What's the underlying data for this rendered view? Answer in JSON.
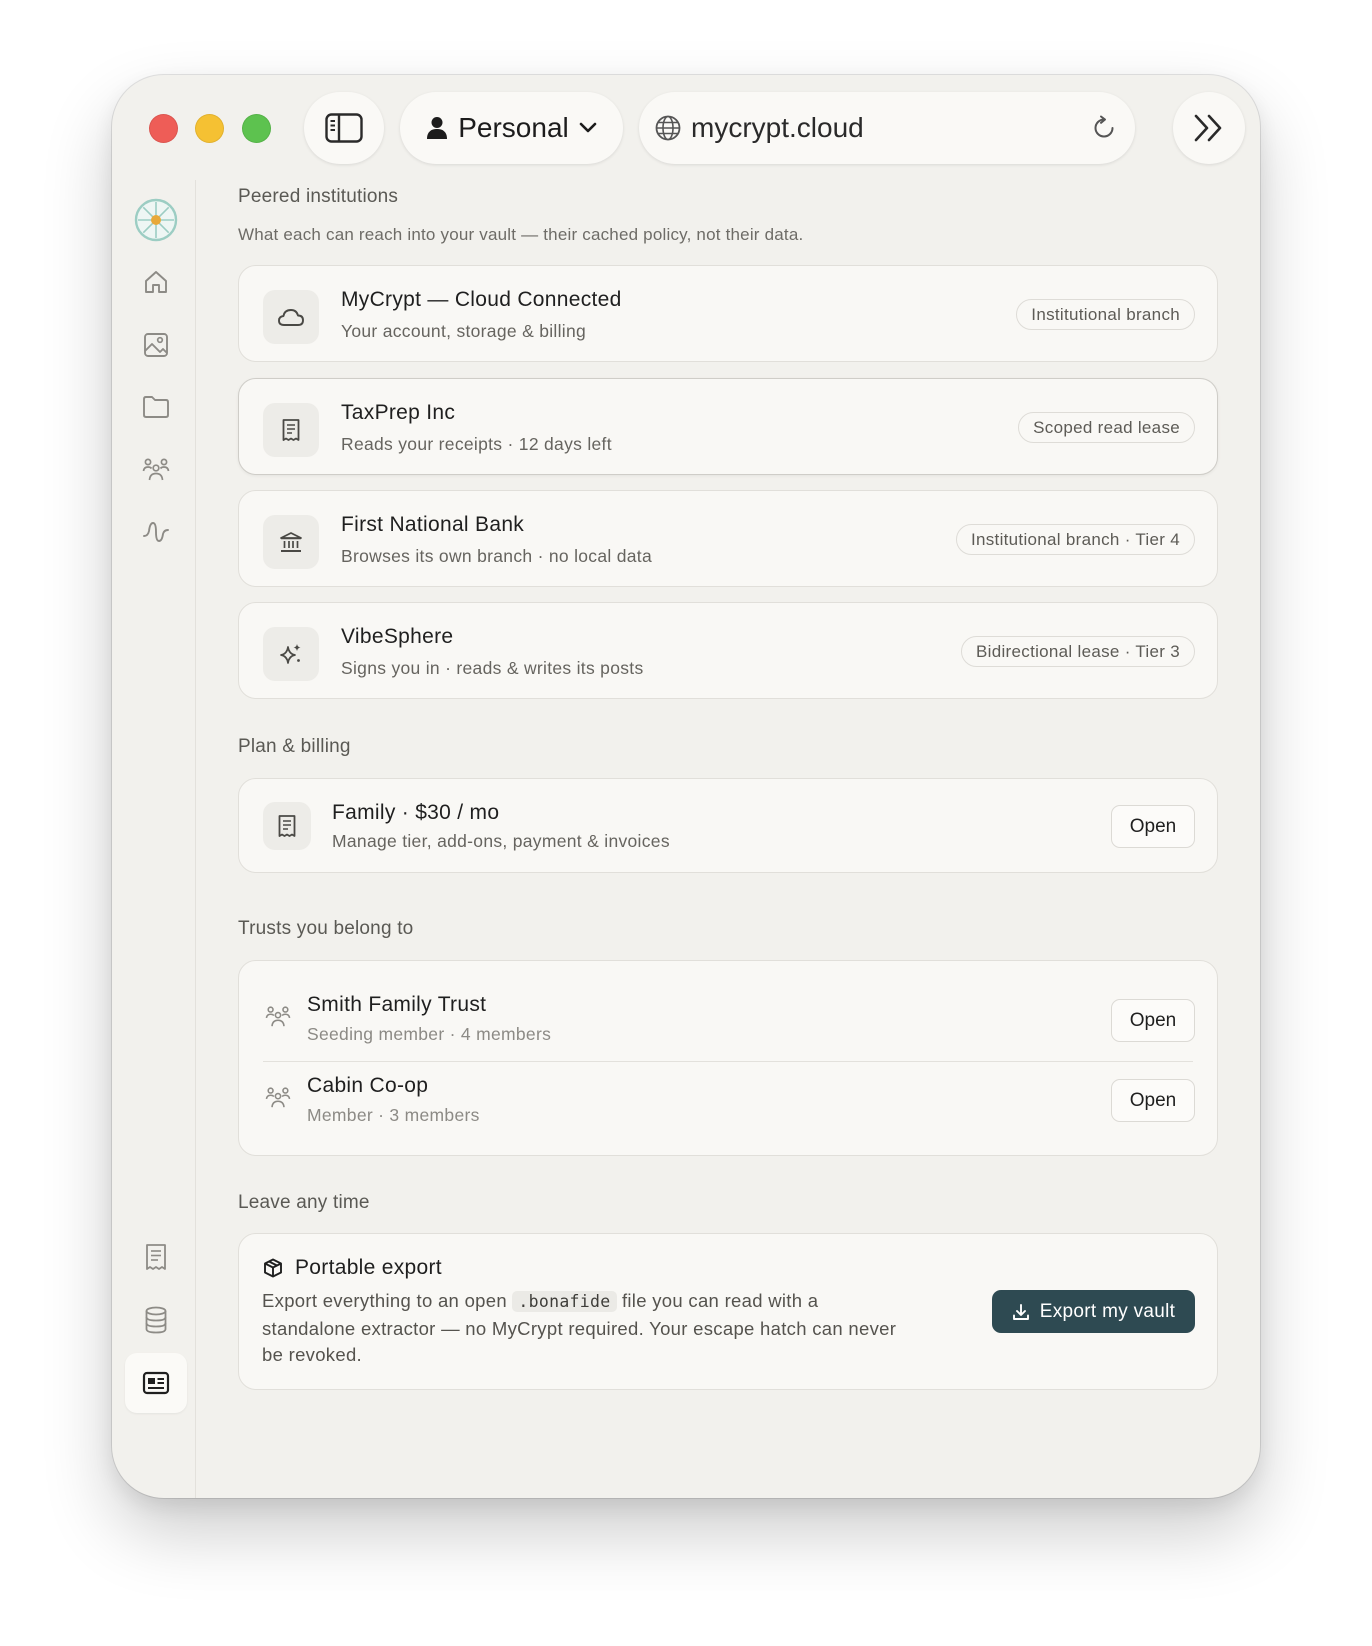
{
  "titlebar": {
    "profile_label": "Personal",
    "url": "mycrypt.cloud"
  },
  "sections": {
    "peered_title": "Peered institutions",
    "peered_subtitle": "What each can reach into your vault — their cached policy, not their data.",
    "plan_title": "Plan & billing",
    "trusts_title": "Trusts you belong to",
    "leave_title": "Leave any time"
  },
  "institutions": [
    {
      "name": "MyCrypt — Cloud Connected",
      "detail": "Your account, storage & billing",
      "tag": "Institutional branch",
      "icon": "cloud-icon"
    },
    {
      "name": "TaxPrep Inc",
      "detail": "Reads your receipts · 12 days left",
      "tag": "Scoped read lease",
      "icon": "receipt-icon"
    },
    {
      "name": "First National Bank",
      "detail": "Browses its own branch · no local data",
      "tag": "Institutional branch · Tier 4",
      "icon": "bank-icon"
    },
    {
      "name": "VibeSphere",
      "detail": "Signs you in · reads & writes its posts",
      "tag": "Bidirectional lease · Tier 3",
      "icon": "sparkles-icon"
    }
  ],
  "plan": {
    "name": "Family · $30 / mo",
    "detail": "Manage tier, add-ons, payment & invoices",
    "button": "Open"
  },
  "trusts": [
    {
      "name": "Smith Family Trust",
      "meta": "Seeding member · 4 members",
      "button": "Open"
    },
    {
      "name": "Cabin Co-op",
      "meta": "Member · 3 members",
      "button": "Open"
    }
  ],
  "export": {
    "title": "Portable export",
    "body_before": "Export everything to an open ",
    "code": ".bonafide",
    "body_after": " file you can read with a standalone extractor — no MyCrypt required. Your escape hatch can never be revoked.",
    "button": "Export my vault"
  },
  "colors": {
    "accent": "#2e4a52",
    "window_bg": "#f2f1ed",
    "card_bg": "#f9f8f5",
    "close": "#ee5d57",
    "minimize": "#f5c133",
    "maximize": "#5dc24f"
  }
}
